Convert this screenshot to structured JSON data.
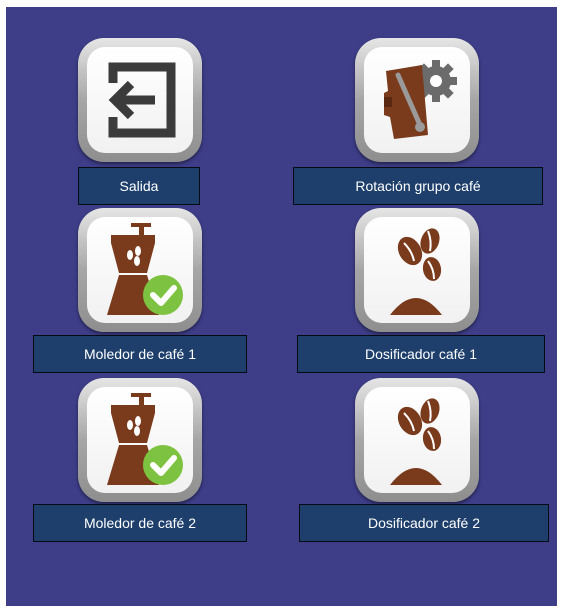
{
  "buttons": [
    {
      "label": "Salida",
      "icon": "exit-icon"
    },
    {
      "label": "Rotación grupo café",
      "icon": "group-rotation-icon"
    },
    {
      "label": "Moledor de café 1",
      "icon": "coffee-grinder-check-icon"
    },
    {
      "label": "Dosificador café 1",
      "icon": "coffee-doser-icon"
    },
    {
      "label": "Moledor de café 2",
      "icon": "coffee-grinder-check-icon"
    },
    {
      "label": "Dosificador café 2",
      "icon": "coffee-doser-icon"
    }
  ],
  "colors": {
    "background": "#3d3d88",
    "label_bg": "#1e3f6b",
    "icon_brown": "#7a3a1c",
    "check_green": "#7dc241"
  }
}
